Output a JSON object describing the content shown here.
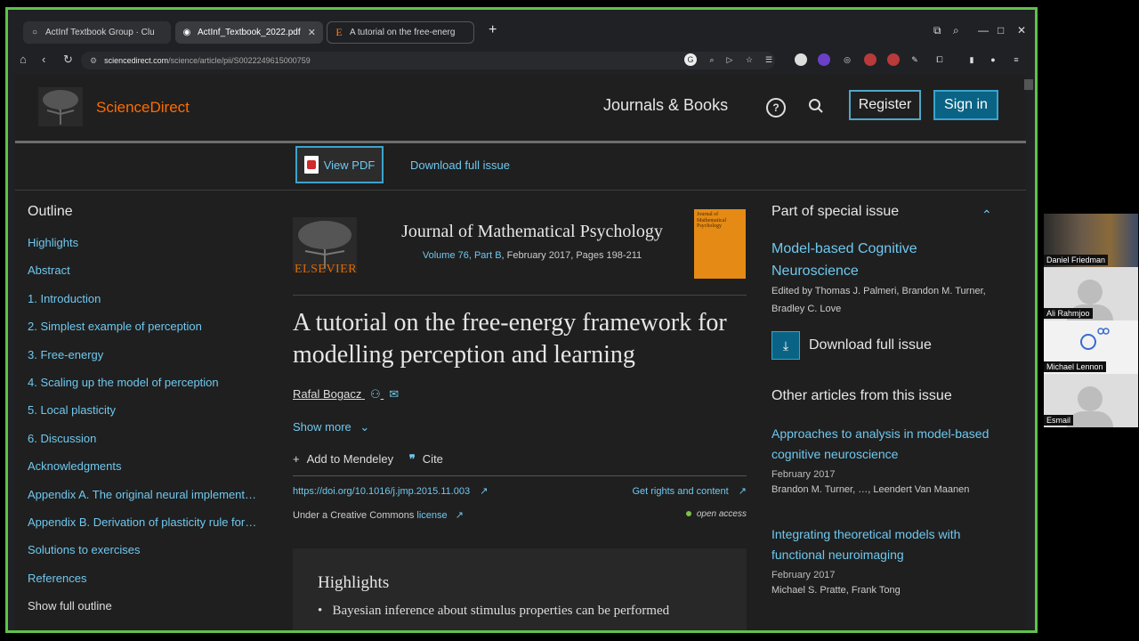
{
  "browser": {
    "tabs": [
      {
        "label": "ActInf Textbook Group · Clu",
        "icon": "circle-icon"
      },
      {
        "label": "ActInf_Textbook_2022.pdf",
        "icon": "globe-icon"
      },
      {
        "label": "A tutorial on the free-energ",
        "icon": "elsevier-e-icon"
      }
    ],
    "new_tab": "+",
    "address": {
      "host": "sciencedirect.com",
      "path": "/science/article/pii/S0022249615000759"
    }
  },
  "header": {
    "logo": "ScienceDirect",
    "journals_books": "Journals & Books",
    "register": "Register",
    "sign_in": "Sign in"
  },
  "toolbar": {
    "view_pdf": "View PDF",
    "download_full_issue": "Download full issue"
  },
  "outline": {
    "title": "Outline",
    "items": [
      "Highlights",
      "Abstract",
      "1. Introduction",
      "2. Simplest example of perception",
      "3. Free-energy",
      "4. Scaling up the model of perception",
      "5. Local plasticity",
      "6. Discussion",
      "Acknowledgments",
      "Appendix A. The original neural implement…",
      "Appendix B. Derivation of plasticity rule for…",
      "Solutions to exercises",
      "References"
    ],
    "show_full": "Show full outline"
  },
  "article": {
    "publisher_logo": "ELSEVIER",
    "journal": "Journal of Mathematical Psychology",
    "volume_link": "Volume 76, Part B",
    "volume_rest": ", February 2017, Pages 198-211",
    "cover_text": "Journal of Mathematical Psychology",
    "title": "A tutorial on the free-energy framework for modelling perception and learning",
    "author": "Rafal Bogacz",
    "show_more": "Show more",
    "add_mendeley": "Add to Mendeley",
    "cite": "Cite",
    "doi": "https://doi.org/10.1016/j.jmp.2015.11.003",
    "rights": "Get rights and content",
    "cc_prefix": "Under a Creative Commons",
    "cc_link": "license",
    "open_access": "open access",
    "highlights_title": "Highlights",
    "highlight_1": "Bayesian inference about stimulus properties can be performed"
  },
  "sidebar_right": {
    "special_issue_title": "Part of special issue",
    "special_issue_name": "Model-based Cognitive Neuroscience",
    "edited_by": "Edited by Thomas J. Palmeri, Brandon M. Turner, Bradley C. Love",
    "download_full_issue": "Download full issue",
    "other_articles_title": "Other articles from this issue",
    "articles": [
      {
        "title": "Approaches to analysis in model-based cognitive neuroscience",
        "date": "February 2017",
        "authors": "Brandon M. Turner, …, Leendert Van Maanen"
      },
      {
        "title": "Integrating theoretical models with functional neuroimaging",
        "date": "February 2017",
        "authors": "Michael S. Pratte, Frank Tong"
      }
    ]
  },
  "participants": [
    {
      "name": "Daniel Friedman"
    },
    {
      "name": "Ali Rahmjoo"
    },
    {
      "name": "Michael Lennon"
    },
    {
      "name": "Esmail"
    }
  ],
  "colors": {
    "accent_link": "#6fc8ef",
    "brand_orange": "#ff6c00",
    "frame_green": "#5fc24a"
  }
}
